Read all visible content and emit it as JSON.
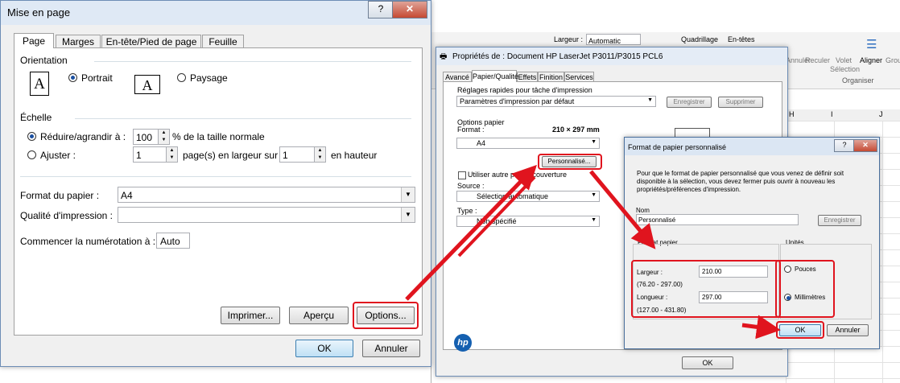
{
  "excel_bg": {
    "ribbon_items": [
      "Largeur :",
      "Automatic",
      "Quadrillage",
      "En-têtes",
      "Annuler",
      "Reculer",
      "Volet",
      "Sélection",
      "Aligner",
      "Grou",
      "Organiser"
    ],
    "col_headers": [
      "H",
      "I",
      "J"
    ]
  },
  "mise_en_page": {
    "title": "Mise en page",
    "help": "?",
    "close": "✕",
    "tabs": [
      "Page",
      "Marges",
      "En-tête/Pied de page",
      "Feuille"
    ],
    "orientation_label": "Orientation",
    "portrait": "Portrait",
    "paysage": "Paysage",
    "orient_glyph": "A",
    "echelle_label": "Échelle",
    "reduire_label": "Réduire/agrandir à :",
    "reduire_value": "100",
    "reduire_suffix": "% de la taille normale",
    "ajuster_label": "Ajuster :",
    "ajuster_w": "1",
    "ajuster_w_suffix": "page(s) en largeur sur",
    "ajuster_h": "1",
    "ajuster_h_suffix": "en hauteur",
    "format_label": "Format du papier :",
    "format_value": "A4",
    "qualite_label": "Qualité d'impression :",
    "qualite_value": "",
    "num_label": "Commencer la numérotation à :",
    "num_value": "Auto",
    "imprimer": "Imprimer...",
    "apercu": "Aperçu",
    "options": "Options...",
    "ok": "OK",
    "annuler": "Annuler"
  },
  "proprietes": {
    "title": "Propriétés de : Document HP LaserJet P3011/P3015 PCL6",
    "tabs": [
      "Avancé",
      "Papier/Qualité",
      "Effets",
      "Finition",
      "Services"
    ],
    "reglages_label": "Réglages rapides pour tâche d'impression",
    "reglages_value": "Paramètres d'impression par défaut",
    "enregistrer": "Enregistrer",
    "supprimer": "Supprimer",
    "options_papier": "Options papier",
    "format_label": "Format :",
    "format_size": "210 × 297 mm",
    "format_value": "A4",
    "personnalise": "Personnalisé...",
    "autre_papier": "Utiliser autre papier/couverture",
    "source_label": "Source :",
    "source_value": "Sélection automatique",
    "type_label": "Type :",
    "type_value": "Non spécifié",
    "ok": "OK",
    "hp": "hp"
  },
  "format_perso": {
    "title": "Format de papier personnalisé",
    "help": "?",
    "close": "✕",
    "info": "Pour que le format de papier personnalisé que vous venez de définir soit disponible à la sélection, vous devez fermer puis ouvrir à nouveau les propriétés/préférences d'impression.",
    "nom_label": "Nom",
    "nom_value": "Personnalisé",
    "enregistrer": "Enregistrer",
    "format_papier": "Format papier",
    "unites": "Unités",
    "largeur_label": "Largeur :",
    "largeur_value": "210.00",
    "largeur_range": "(76.20 - 297.00)",
    "longueur_label": "Longueur :",
    "longueur_value": "297.00",
    "longueur_range": "(127.00 - 431.80)",
    "pouces": "Pouces",
    "millimetres": "Millimètres",
    "ok": "OK",
    "annuler": "Annuler"
  }
}
